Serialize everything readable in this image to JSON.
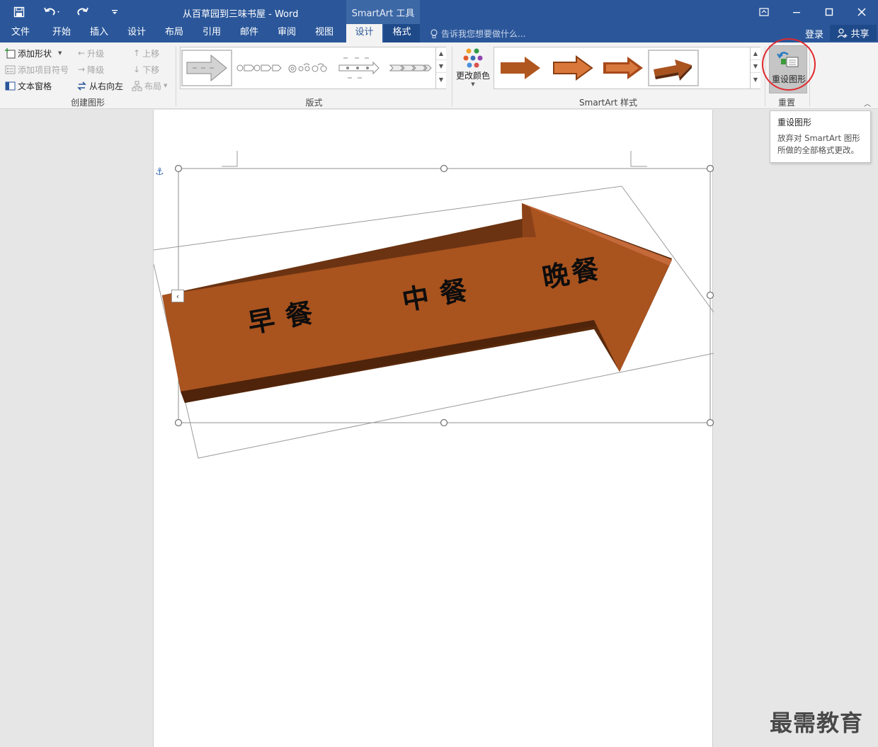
{
  "window": {
    "title": "从百草园到三味书屋 - Word",
    "context_tab": "SmartArt 工具"
  },
  "menu": {
    "tabs": [
      "文件",
      "开始",
      "插入",
      "设计",
      "布局",
      "引用",
      "邮件",
      "审阅",
      "视图",
      "设计",
      "格式"
    ],
    "active_index": 9,
    "tell_me": "告诉我您想要做什么...",
    "login": "登录",
    "share": "共享"
  },
  "ribbon": {
    "create_graphic": {
      "label": "创建图形",
      "add_shape": "添加形状",
      "add_bullet": "添加项目符号",
      "text_pane": "文本窗格",
      "promote": "升级",
      "demote": "降级",
      "right_to_left": "从右向左",
      "move_up": "上移",
      "move_down": "下移",
      "layout": "布局"
    },
    "layouts": {
      "label": "版式"
    },
    "styles": {
      "label": "SmartArt 样式",
      "change_colors": "更改颜色"
    },
    "reset": {
      "label": "重置",
      "reset_graphic": "重设图形"
    }
  },
  "tooltip": {
    "title": "重设图形",
    "body_line1": "放弃对 SmartArt 图形",
    "body_line2": "所做的全部格式更改。"
  },
  "smartart": {
    "items": [
      "早餐",
      "中餐",
      "晚餐"
    ],
    "arrow_color": "#a9531f"
  },
  "watermark": "最需教育"
}
